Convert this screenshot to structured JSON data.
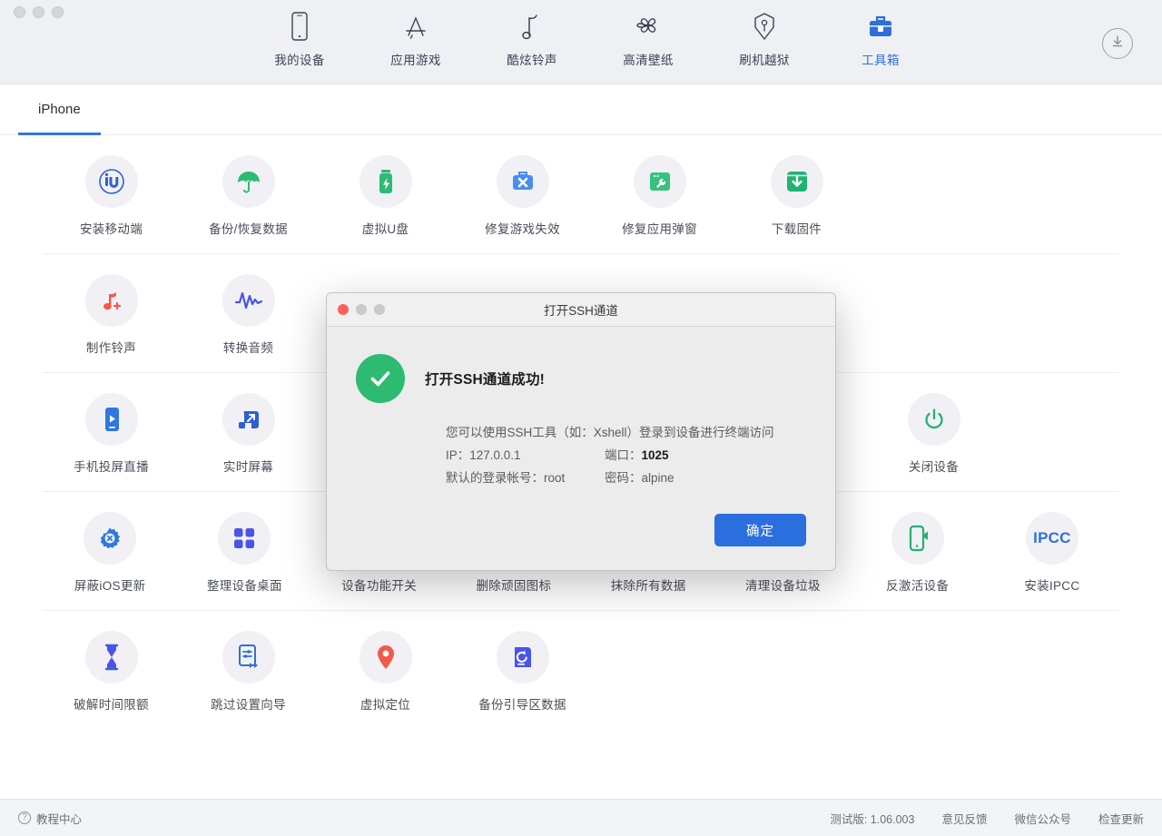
{
  "window": {
    "traffic_lights": [
      "close",
      "minimize",
      "maximize"
    ]
  },
  "nav": {
    "items": [
      {
        "label": "我的设备",
        "icon": "phone-icon",
        "active": false
      },
      {
        "label": "应用游戏",
        "icon": "appstore-icon",
        "active": false
      },
      {
        "label": "酷炫铃声",
        "icon": "music-note-icon",
        "active": false
      },
      {
        "label": "高清壁纸",
        "icon": "flower-icon",
        "active": false
      },
      {
        "label": "刷机越狱",
        "icon": "shield-key-icon",
        "active": false
      },
      {
        "label": "工具箱",
        "icon": "toolbox-icon",
        "active": true
      }
    ],
    "download_button": "download-icon"
  },
  "tabs": [
    {
      "label": "iPhone",
      "active": true
    }
  ],
  "tools": {
    "rows": [
      [
        {
          "label": "安装移动端",
          "icon": "iu-logo-icon",
          "color": "#2f5fd0"
        },
        {
          "label": "备份/恢复数据",
          "icon": "umbrella-icon",
          "color": "#2dbb72"
        },
        {
          "label": "虚拟U盘",
          "icon": "usb-flash-icon",
          "color": "#2dbb72"
        },
        {
          "label": "修复游戏失效",
          "icon": "toolbox-fix-icon",
          "color": "#4a8df0"
        },
        {
          "label": "修复应用弹窗",
          "icon": "window-wrench-icon",
          "color": "#35c27d"
        },
        {
          "label": "下载固件",
          "icon": "download-box-icon",
          "color": "#20b473"
        }
      ],
      [
        {
          "label": "制作铃声",
          "icon": "music-add-icon",
          "color": "#f2594b"
        },
        {
          "label": "转换音频",
          "icon": "waveform-icon",
          "color": "#4a54e8"
        }
      ],
      [
        {
          "label": "手机投屏直播",
          "icon": "phone-play-icon",
          "color": "#2f78dd"
        },
        {
          "label": "实时屏幕",
          "icon": "screen-mirror-icon",
          "color": "#2f5fd0"
        },
        {
          "label": "",
          "icon": "",
          "color": ""
        },
        {
          "label": "",
          "icon": "",
          "color": ""
        },
        {
          "label": "",
          "icon": "",
          "color": ""
        },
        {
          "label": "",
          "icon": "",
          "color": ""
        },
        {
          "label": "关闭设备",
          "icon": "power-icon",
          "color": "#23b271"
        }
      ],
      [
        {
          "label": "屏蔽iOS更新",
          "icon": "gear-block-icon",
          "color": "#2f78dd"
        },
        {
          "label": "整理设备桌面",
          "icon": "grid-apps-icon",
          "color": "#4a54e8"
        },
        {
          "label": "设备功能开关",
          "icon": "toggles-icon",
          "color": "#23b271"
        },
        {
          "label": "删除顽固图标",
          "icon": "trash-icon",
          "color": "#e1453c"
        },
        {
          "label": "抹除所有数据",
          "icon": "broom-erase-icon",
          "color": "#2f5fd0"
        },
        {
          "label": "清理设备垃圾",
          "icon": "broom-clean-icon",
          "color": "#e1453c"
        },
        {
          "label": "反激活设备",
          "icon": "phone-deactivate-icon",
          "color": "#23b271"
        },
        {
          "label": "安装IPCC",
          "icon": "ipcc-text-icon",
          "color": "#2f6fd8"
        }
      ],
      [
        {
          "label": "破解时间限额",
          "icon": "hourglass-icon",
          "color": "#4a54e8"
        },
        {
          "label": "跳过设置向导",
          "icon": "skip-setup-icon",
          "color": "#2f6fd8"
        },
        {
          "label": "虚拟定位",
          "icon": "location-pin-icon",
          "color": "#f2594b"
        },
        {
          "label": "备份引导区数据",
          "icon": "disk-restore-icon",
          "color": "#4a54e8"
        }
      ]
    ]
  },
  "statusbar": {
    "tutorial": "教程中心",
    "version": "测试版: 1.06.003",
    "feedback": "意见反馈",
    "wechat": "微信公众号",
    "check_update": "检查更新"
  },
  "dialog": {
    "title": "打开SSH通道",
    "success_text": "打开SSH通道成功!",
    "desc": "您可以使用SSH工具（如：Xshell）登录到设备进行终端访问",
    "ip_label": "IP：127.0.0.1",
    "port_label": "端口：",
    "port_value": "1025",
    "account_label": "默认的登录帐号：root",
    "password_label": "密码：alpine",
    "confirm": "确定",
    "accent": "#2a6fdd",
    "success_color": "#2dbb72"
  }
}
